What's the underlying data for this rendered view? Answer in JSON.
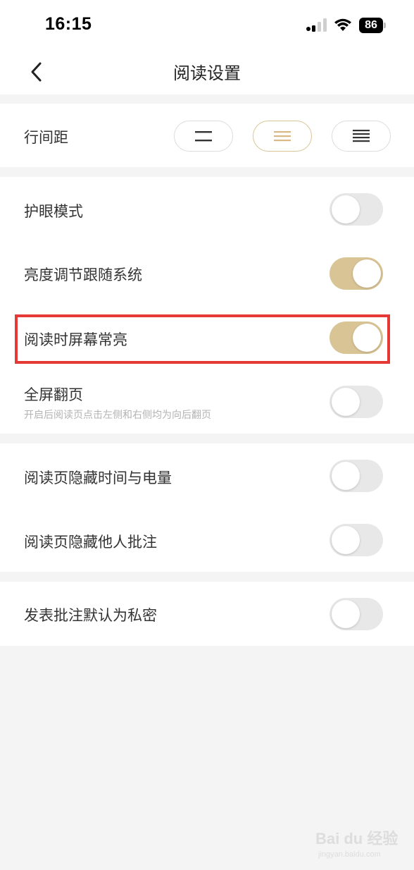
{
  "status_bar": {
    "time": "16:15",
    "battery": "86"
  },
  "nav": {
    "title": "阅读设置"
  },
  "line_spacing": {
    "label": "行间距",
    "options": [
      "small",
      "medium",
      "large"
    ],
    "selected": "medium"
  },
  "settings": [
    {
      "label": "护眼模式",
      "on": false
    },
    {
      "label": "亮度调节跟随系统",
      "on": true
    },
    {
      "label": "阅读时屏幕常亮",
      "on": true
    },
    {
      "label": "全屏翻页",
      "sublabel": "开启后阅读页点击左侧和右侧均为向后翻页",
      "on": false
    },
    {
      "label": "阅读页隐藏时间与电量",
      "on": false
    },
    {
      "label": "阅读页隐藏他人批注",
      "on": false
    },
    {
      "label": "发表批注默认为私密",
      "on": false
    }
  ],
  "colors": {
    "accent": "#d9c495",
    "highlight": "#e53935",
    "toggle_off": "#e8e8e8"
  },
  "watermark": {
    "text": "Bai du 经验",
    "sub": "jingyan.baidu.com"
  }
}
